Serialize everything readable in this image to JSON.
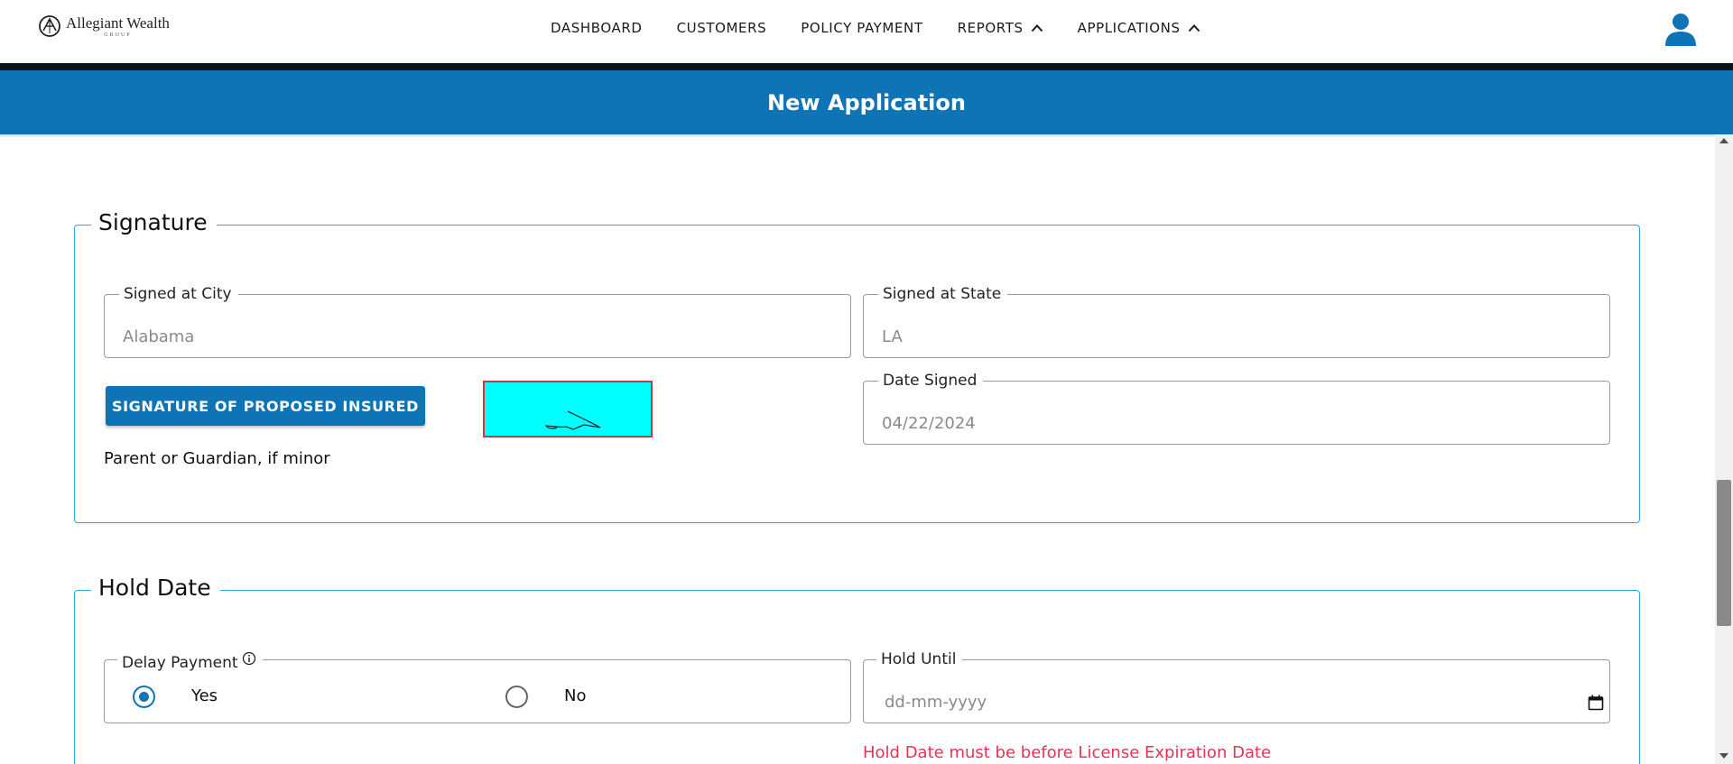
{
  "brand": {
    "name": "Allegiant Wealth",
    "sub": "GROUP"
  },
  "nav": {
    "dashboard": "DASHBOARD",
    "customers": "CUSTOMERS",
    "policy_payment": "POLICY PAYMENT",
    "reports": "REPORTS",
    "applications": "APPLICATIONS"
  },
  "banner": {
    "title": "New Application"
  },
  "signature": {
    "legend": "Signature",
    "city_label": "Signed at City",
    "city_value": "Alabama",
    "state_label": "Signed at State",
    "state_value": "LA",
    "button_label": "SIGNATURE OF PROPOSED INSURED",
    "guardian_note": "Parent or Guardian, if minor",
    "date_label": "Date Signed",
    "date_value": "04/22/2024"
  },
  "hold": {
    "legend": "Hold Date",
    "delay_label": "Delay Payment",
    "yes_label": "Yes",
    "no_label": "No",
    "selected": "Yes",
    "hold_until_label": "Hold Until",
    "hold_until_placeholder": "dd-mm-yyyy",
    "error": "Hold Date must be before License Expiration Date"
  },
  "colors": {
    "primary": "#0f74b6",
    "section_border": "#29a9d8",
    "signature_bg": "#00ffff",
    "signature_border": "#d0373a",
    "error": "#e8334f"
  },
  "icons": {
    "user": "user-icon",
    "chevron": "chevron-up-icon",
    "info": "info-icon",
    "calendar": "calendar-icon"
  }
}
